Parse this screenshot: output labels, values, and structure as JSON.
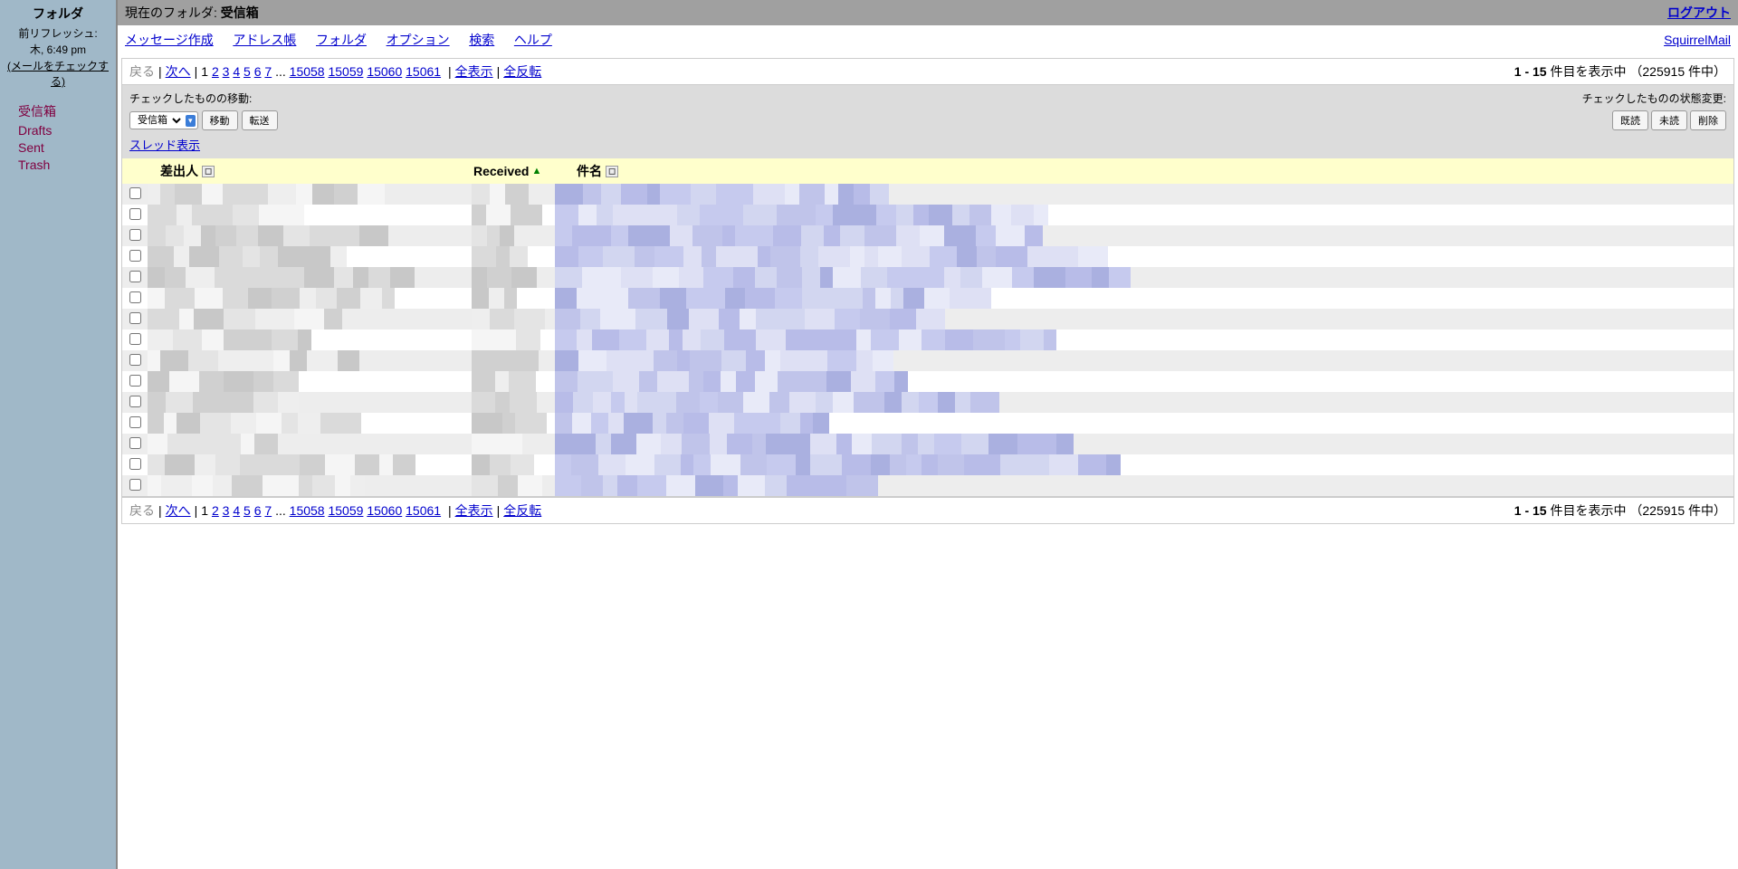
{
  "sidebar": {
    "title": "フォルダ",
    "refresh_label": "前リフレッシュ:",
    "time": "木, 6:49 pm",
    "check_mail": "(メールをチェックする)",
    "folders": [
      {
        "label": "受信箱"
      },
      {
        "label": "Drafts"
      },
      {
        "label": "Sent"
      },
      {
        "label": "Trash"
      }
    ]
  },
  "header": {
    "current_label": "現在のフォルダ: ",
    "current_folder": "受信箱",
    "logout": "ログアウト"
  },
  "menu": {
    "compose": "メッセージ作成",
    "address": "アドレス帳",
    "folders": "フォルダ",
    "options": "オプション",
    "search": "検索",
    "help": "ヘルプ",
    "brand": "SquirrelMail"
  },
  "nav": {
    "back": "戻る",
    "next": "次へ",
    "pages_early": [
      "1",
      "2",
      "3",
      "4",
      "5",
      "6",
      "7"
    ],
    "ellipsis": "...",
    "pages_late": [
      "15058",
      "15059",
      "15060",
      "15061"
    ],
    "show_all": "全表示",
    "toggle_all": "全反転",
    "status_prefix": "1 - 15",
    "status_mid": " 件目を表示中 （",
    "status_count": "225915",
    "status_suffix": " 件中）"
  },
  "actions": {
    "move_label": "チェックしたものの移動:",
    "state_label": "チェックしたものの状態変更:",
    "select_value": "受信箱",
    "move_btn": "移動",
    "forward_btn": "転送",
    "read_btn": "既読",
    "unread_btn": "未読",
    "delete_btn": "削除",
    "thread_view": "スレッド表示"
  },
  "table": {
    "from": "差出人",
    "received": "Received",
    "subject": "件名"
  },
  "rows": 15
}
